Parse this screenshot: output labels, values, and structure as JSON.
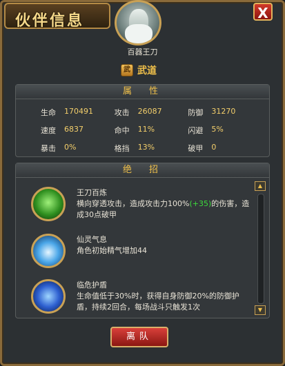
{
  "window": {
    "title": "伙伴信息",
    "close_label": "X"
  },
  "hero": {
    "name": "百器王刀",
    "faction_icon_char": "武",
    "faction": "武道"
  },
  "attributes": {
    "header": "属　性",
    "rows": [
      [
        {
          "label": "生命",
          "value": "170491"
        },
        {
          "label": "攻击",
          "value": "26087"
        },
        {
          "label": "防御",
          "value": "31270"
        }
      ],
      [
        {
          "label": "速度",
          "value": "6837"
        },
        {
          "label": "命中",
          "value": "11%"
        },
        {
          "label": "闪避",
          "value": "5%"
        }
      ],
      [
        {
          "label": "暴击",
          "value": "0%"
        },
        {
          "label": "格挡",
          "value": "13%"
        },
        {
          "label": "破甲",
          "value": "0"
        }
      ]
    ]
  },
  "skills": {
    "header": "绝　招",
    "items": [
      {
        "name": "王刀百炼",
        "desc_before": "横向穿透攻击，造成攻击力100%",
        "desc_bonus": "(+35)",
        "desc_after": "的伤害，造成30点破甲",
        "icon": "green-blade-icon",
        "color": "#3fbf3a"
      },
      {
        "name": "仙灵气息",
        "desc_before": "角色初始精气增加44",
        "desc_bonus": "",
        "desc_after": "",
        "icon": "blue-aura-icon",
        "color": "#4aa6e8"
      },
      {
        "name": "临危护盾",
        "desc_before": "生命值低于30%时，获得自身防御20%的防御护盾，持续2回合，每场战斗只触发1次",
        "desc_bonus": "",
        "desc_after": "",
        "icon": "shield-spirit-icon",
        "color": "#3a6fe0"
      }
    ]
  },
  "scroll": {
    "up_icon": "▲",
    "down_icon": "▼"
  },
  "actions": {
    "leave_label": "离队"
  },
  "colors": {
    "accent_gold": "#f0c04a",
    "value_yellow": "#f4cf6b",
    "bonus_green": "#3ddc3d",
    "button_red": "#d8403a"
  }
}
